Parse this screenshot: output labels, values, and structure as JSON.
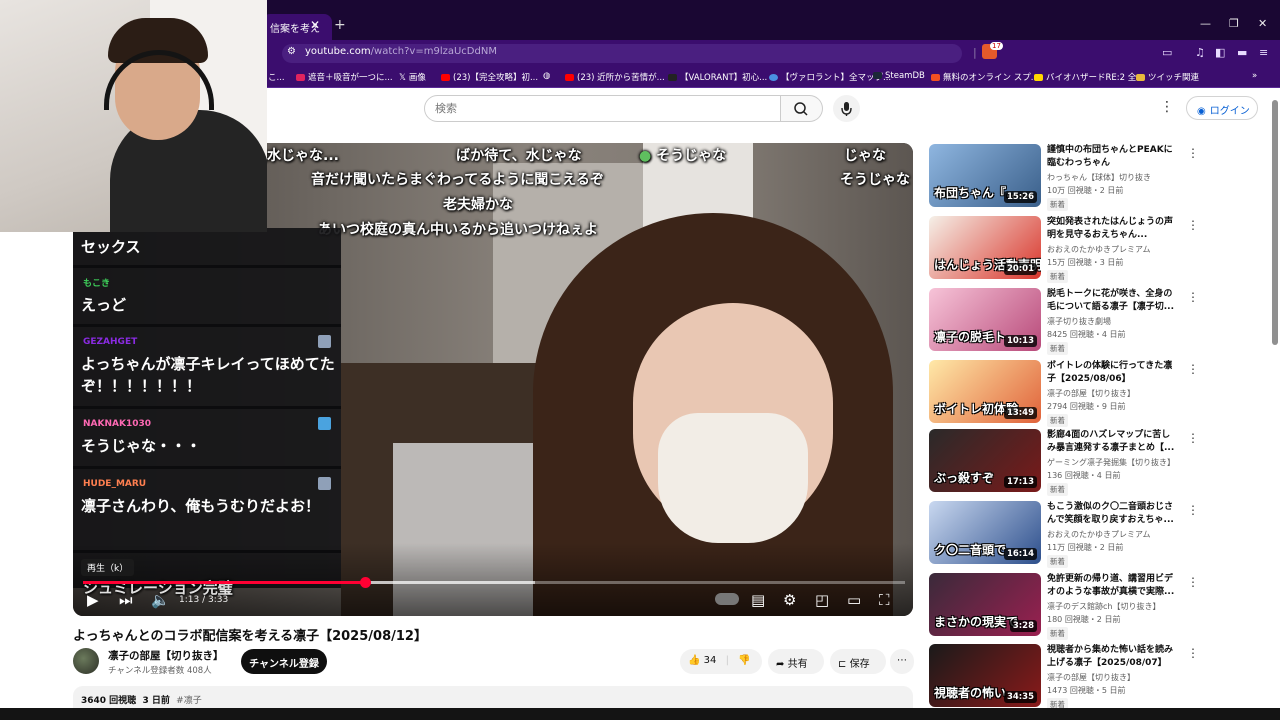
{
  "browser": {
    "active_tab_title": "信案を考え",
    "url_host": "youtube.com",
    "url_path": "/watch?v=m9lzaUcDdNM",
    "ext_badge": "17",
    "bookmarks": [
      {
        "label": "遮音＋吸音が一つに...",
        "color": "#e0245e"
      },
      {
        "label": "画像",
        "color": "#ffffff"
      },
      {
        "label": "(23)【完全攻略】初...",
        "color": "#ff0000"
      },
      {
        "label": "(23) 近所から苦情が...",
        "color": "#ff0000"
      },
      {
        "label": "【VALORANT】初心...",
        "color": "#222222"
      },
      {
        "label": "【ヴァロラント】全マップ...",
        "color": "#4a90e2"
      },
      {
        "label": "SteamDB",
        "color": "#1b2838"
      },
      {
        "label": "無料のオンライン スプ...",
        "color": "#f25022"
      },
      {
        "label": "バイオハザードRE:2 全...",
        "color": "#ffd700"
      },
      {
        "label": "ツイッチ関連",
        "color": "#e8b93c"
      }
    ],
    "bookmark_prefix": "こ..."
  },
  "header": {
    "search_placeholder": "検索",
    "login_label": "ログイン"
  },
  "player": {
    "chat": [
      {
        "name": "",
        "message": "セックス",
        "name_color": "#ffffff"
      },
      {
        "name": "もこき",
        "message": "えっど",
        "name_color": "#3ecf5a"
      },
      {
        "name": "GEZAHGET",
        "message": "よっちゃんが凛子キレイってほめてたぞ！！！！！！！",
        "name_color": "#8a2be2"
      },
      {
        "name": "NAKNAK1030",
        "message": "そうじゃな・・・",
        "name_color": "#ff69b4"
      },
      {
        "name": "HUDE_MARU",
        "message": "凛子さんわり、俺もうむりだよお！",
        "name_color": "#ff7f50"
      }
    ],
    "subtitles": [
      "給水じゃな...",
      "ばか待て、水じゃな",
      "そうじゃな",
      "じゃな",
      "音だけ聞いたらまぐわってるように聞こえるぞ",
      "そうじゃな",
      "老夫婦かな",
      "あいつ校庭の真ん中いるから追いつけねぇよ"
    ],
    "overlay_bottom_text": "シュミレーション完璧",
    "tooltip": "再生（k）",
    "time_current": "1:13",
    "time_total": "3:33",
    "progress": 0.343,
    "buffered": 0.55
  },
  "video": {
    "title": "よっちゃんとのコラボ配信案を考える凛子【2025/08/12】",
    "channel_name": "凛子の部屋【切り抜き】",
    "subscribers": "チャンネル登録者数 408人",
    "subscribe_label": "チャンネル登録",
    "likes": "34",
    "share_label": "共有",
    "save_label": "保存",
    "views": "3640 回視聴",
    "age": "3 日前",
    "hashtag": "#凛子"
  },
  "recommendations": [
    {
      "title": "謹慎中の布団ちゃんとPEAKに臨むわっちゃん",
      "channel": "わっちゃん【球体】切り抜き",
      "meta": "10万 回視聴・2 日前",
      "badge": "新着",
      "duration": "15:26",
      "thumb_text": "布団ちゃん『......",
      "thumb_colors": [
        "#8fb6e0",
        "#3a5f8a"
      ]
    },
    {
      "title": "突如発表されたはんじょうの声明を見守るおえちゃん...",
      "channel": "おおえのたかゆきプレミアム",
      "meta": "15万 回視聴・3 日前",
      "badge": "新着",
      "duration": "20:01",
      "thumb_text": "はんじょう活動声明",
      "thumb_colors": [
        "#f5f0e8",
        "#d9352b"
      ]
    },
    {
      "title": "脱毛トークに花が咲き、全身の毛について語る凛子【凛子切...",
      "channel": "凛子切り抜き劇場",
      "meta": "8425 回視聴・4 日前",
      "badge": "新着",
      "duration": "10:13",
      "thumb_text": "凛子の脱毛ト",
      "thumb_colors": [
        "#f7c4d8",
        "#b84a7a"
      ]
    },
    {
      "title": "ボイトレの体験に行ってきた凛子【2025/08/06】",
      "channel": "凛子の部屋【切り抜き】",
      "meta": "2794 回視聴・9 日前",
      "badge": "新着",
      "duration": "13:49",
      "thumb_text": "ボイトレ初体験",
      "thumb_colors": [
        "#ffe9a8",
        "#e0623a"
      ]
    },
    {
      "title": "影廊4面のハズレマップに苦しみ暴言連発する凛子まとめ【...",
      "channel": "ゲーミング凛子発掘集【切り抜き】",
      "meta": "136 回視聴・4 日前",
      "badge": "新着",
      "duration": "17:13",
      "thumb_text": "ぶっ殺すぞ",
      "thumb_colors": [
        "#2a2a2a",
        "#7a1a1a"
      ]
    },
    {
      "title": "もこう激似のク〇二音頭おじさんで笑顔を取り戻すおえちゃ...",
      "channel": "おおえのたかゆきプレミアム",
      "meta": "11万 回視聴・2 日前",
      "badge": "新着",
      "duration": "16:14",
      "thumb_text": "ク〇二音頭で",
      "thumb_colors": [
        "#c9d8f0",
        "#2d4f8c"
      ]
    },
    {
      "title": "免許更新の帰り道、講習用ビデオのような事故が真横で実際...",
      "channel": "凛子のデス館跡ch【切り抜き】",
      "meta": "180 回視聴・2 日前",
      "badge": "新着",
      "duration": "3:28",
      "thumb_text": "まさかの現実で",
      "thumb_colors": [
        "#3a2a3a",
        "#9a2050"
      ]
    },
    {
      "title": "視聴者から集めた怖い話を読み上げる凛子【2025/08/07】",
      "channel": "凛子の部屋【切り抜き】",
      "meta": "1473 回視聴・5 日前",
      "badge": "新着",
      "duration": "34:35",
      "thumb_text": "視聴者の怖い",
      "thumb_colors": [
        "#1a1a1a",
        "#8a1a1a"
      ]
    }
  ]
}
